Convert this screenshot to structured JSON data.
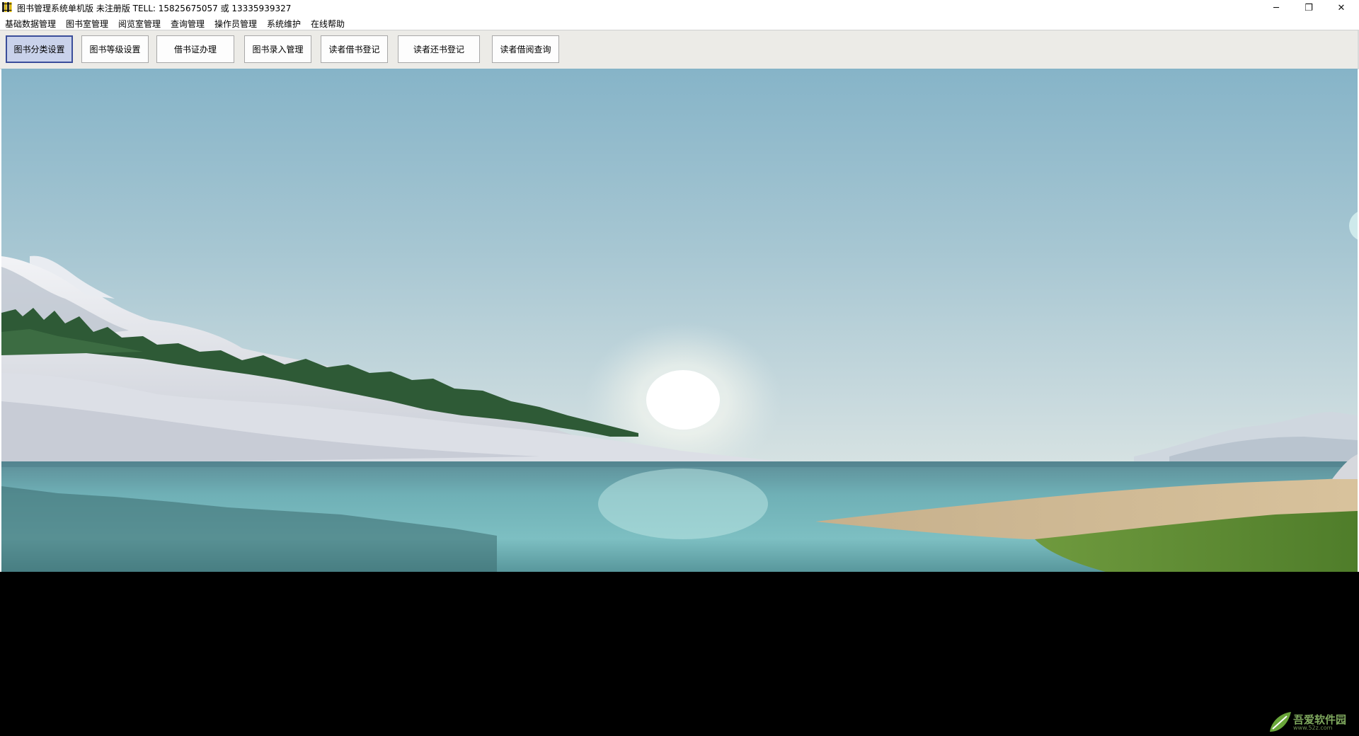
{
  "window": {
    "title": "图书管理系统单机版 未注册版 TELL: 15825675057 或 13335939327",
    "minimize_glyph": "─",
    "restore_glyph": "❐",
    "close_glyph": "✕"
  },
  "menu": {
    "items": [
      {
        "label": "基础数据管理"
      },
      {
        "label": "图书室管理"
      },
      {
        "label": "阅览室管理"
      },
      {
        "label": "查询管理"
      },
      {
        "label": "操作员管理"
      },
      {
        "label": "系统维护"
      },
      {
        "label": "在线帮助"
      }
    ]
  },
  "toolbar": {
    "buttons": [
      {
        "label": "图书分类设置",
        "active": true
      },
      {
        "label": "图书等级设置"
      },
      {
        "label": "借书证办理"
      },
      {
        "label": "图书录入管理"
      },
      {
        "label": "读者借书登记"
      },
      {
        "label": "读者还书登记"
      },
      {
        "label": "读者借阅查询"
      }
    ]
  },
  "content": {
    "background": "landscape-wallpaper"
  },
  "watermark": {
    "text": "吾爱软件园",
    "sub": "www.52z.com"
  },
  "colors": {
    "toolbar_bg": "#ecebe7",
    "active_button_bg": "#c9d2eb",
    "active_button_border": "#3a4d9a"
  }
}
